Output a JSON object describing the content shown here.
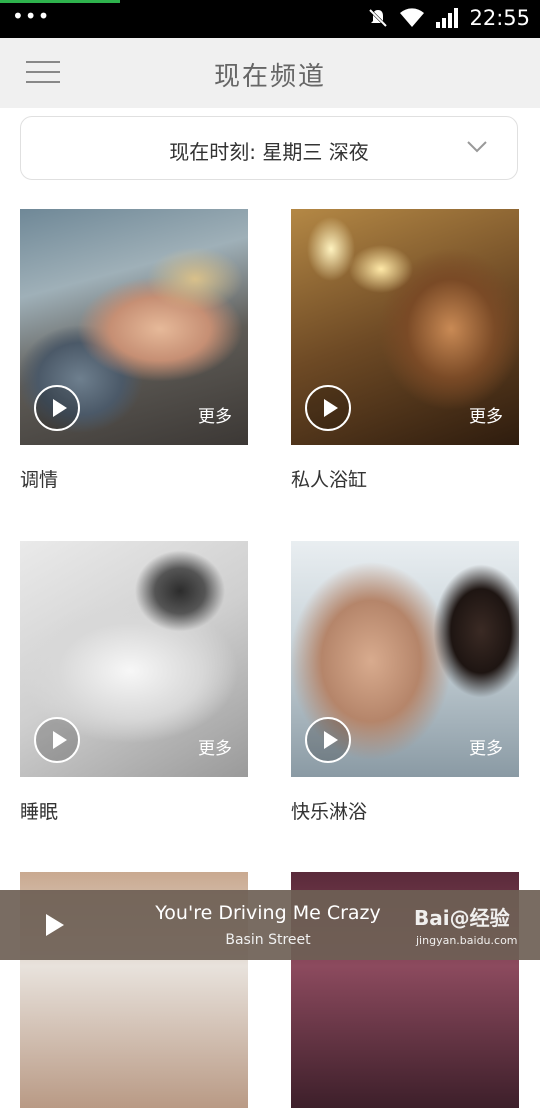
{
  "status_bar": {
    "time": "22:55",
    "icons": [
      "notification-dots",
      "silent-icon",
      "wifi-icon",
      "signal-icon"
    ]
  },
  "header": {
    "title": "现在频道",
    "menu_icon": "hamburger-menu-icon"
  },
  "time_selector": {
    "label": "现在时刻: 星期三 深夜",
    "dropdown_icon": "chevron-down-icon"
  },
  "channels": [
    {
      "name": "调情",
      "more": "更多"
    },
    {
      "name": "私人浴缸",
      "more": "更多"
    },
    {
      "name": "睡眠",
      "more": "更多"
    },
    {
      "name": "快乐淋浴",
      "more": "更多"
    }
  ],
  "player": {
    "song": "You're Driving Me Crazy",
    "artist": "Basin Street",
    "play_icon": "play-icon"
  },
  "watermark": {
    "brand": "Bai@经验",
    "url": "jingyan.baidu.com"
  }
}
